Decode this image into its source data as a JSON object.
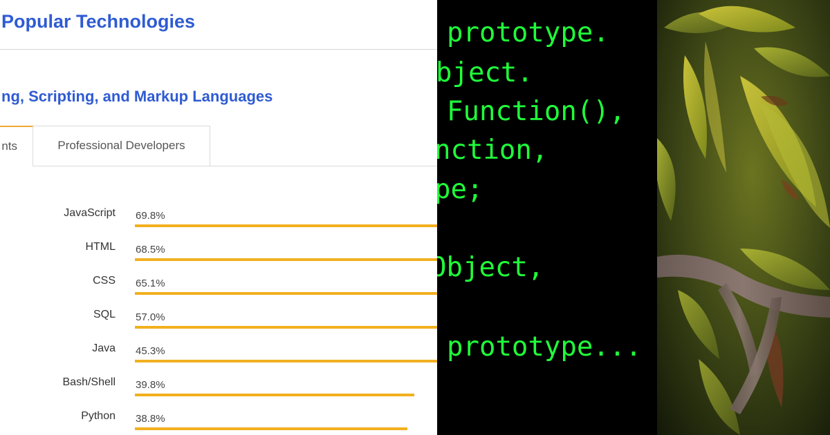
{
  "survey": {
    "title": "Popular Technologies",
    "section_title": "ng, Scripting, and Markup Languages",
    "tabs": [
      {
        "label": "nts",
        "active": true
      },
      {
        "label": "Professional Developers",
        "active": false
      }
    ],
    "accent_color": "#2f5bd3",
    "bar_color": "#f2b01e",
    "tab_active_color": "#f0a830",
    "chart_data": {
      "type": "bar",
      "orientation": "horizontal",
      "categories": [
        "JavaScript",
        "HTML",
        "CSS",
        "SQL",
        "Java",
        "Bash/Shell",
        "Python"
      ],
      "values": [
        69.8,
        68.5,
        65.1,
        57.0,
        45.3,
        39.8,
        38.8
      ],
      "value_labels": [
        "69.8%",
        "68.5%",
        "65.1%",
        "57.0%",
        "45.3%",
        "39.8%",
        "38.8%"
      ],
      "unit": "%"
    }
  },
  "code": {
    "text_color": "#1fff3a",
    "lines": [
      "prototype.",
      "bject.",
      "Function(),",
      "nction,",
      "pe;",
      "Object,",
      "prototype..."
    ]
  },
  "photo": {
    "subject": "leaves-on-branch"
  }
}
